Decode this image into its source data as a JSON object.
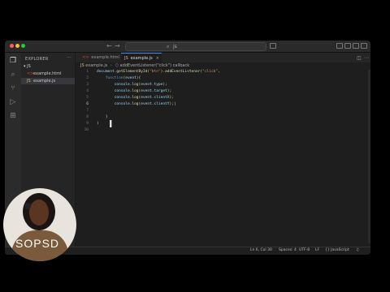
{
  "window": {
    "nav_back": "←",
    "nav_forward": "→",
    "search_query": "js",
    "search_icon": "search-icon"
  },
  "activity_bar": [
    {
      "name": "explorer-icon",
      "glyph": "❐"
    },
    {
      "name": "search-icon",
      "glyph": "⌕"
    },
    {
      "name": "source-control-icon",
      "glyph": "⑂"
    },
    {
      "name": "run-debug-icon",
      "glyph": "▷"
    },
    {
      "name": "extensions-icon",
      "glyph": "⊞"
    }
  ],
  "sidebar": {
    "title": "EXPLORER",
    "more": "···",
    "folder": "JS",
    "files": [
      {
        "icon": "<>",
        "name": "example.html",
        "selected": false
      },
      {
        "icon": "JS",
        "name": "example.js",
        "selected": true
      }
    ]
  },
  "tabs": [
    {
      "icon": "<>",
      "label": "example.html",
      "active": false
    },
    {
      "icon": "JS",
      "label": "example.js",
      "close": "×",
      "active": true
    }
  ],
  "breadcrumb": [
    "example.js",
    "addEventListener(\"click\") callback"
  ],
  "editor": {
    "lines": [
      "1",
      "2",
      "3",
      "4",
      "5",
      "6",
      "7",
      "8",
      "9",
      "10"
    ],
    "current_line": "6"
  },
  "statusbar": {
    "position": "Ln 6, Col 30",
    "spaces": "Spaces: 4",
    "encoding": "UTF-8",
    "eol": "LF",
    "language": "{} JavaScript"
  },
  "webcam": {
    "label": "SOPSD"
  }
}
